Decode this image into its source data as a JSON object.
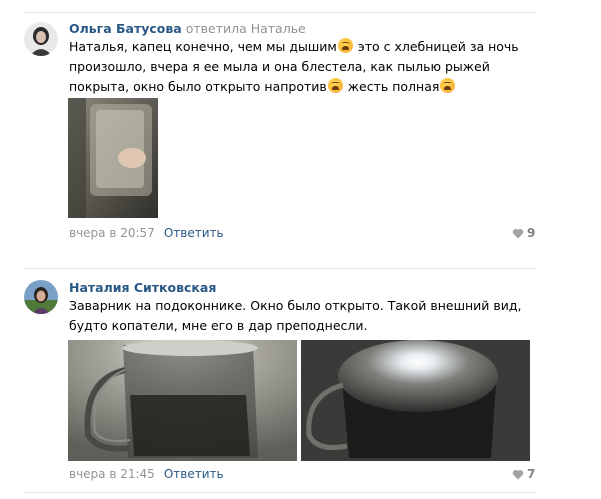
{
  "comments": [
    {
      "author": "Ольга Батусова",
      "reply_to": "ответила Наталье",
      "text_parts": [
        "Наталья, капец конечно, чем мы дышим",
        " это с хлебницей за ночь произошло, вчера я ее мыла и она блестела, как пылью рыжей покрыта, окно было открыто напротив",
        " жесть полная"
      ],
      "emoji": "weary-face",
      "time": "вчера в 20:57",
      "reply_label": "Ответить",
      "likes": "9"
    },
    {
      "author": "Наталия Ситковская",
      "text": "Заварник на подоконнике. Окно было открыто. Такой внешний вид, будто копатели, мне его в дар преподнесли.",
      "time": "вчера в 21:45",
      "reply_label": "Ответить",
      "likes": "7"
    }
  ],
  "icons": {
    "like": "heart-icon",
    "emoji": "weary-face-emoji"
  },
  "colors": {
    "link": "#2a5885",
    "muted": "#939393",
    "divider": "#e7e8ec"
  }
}
